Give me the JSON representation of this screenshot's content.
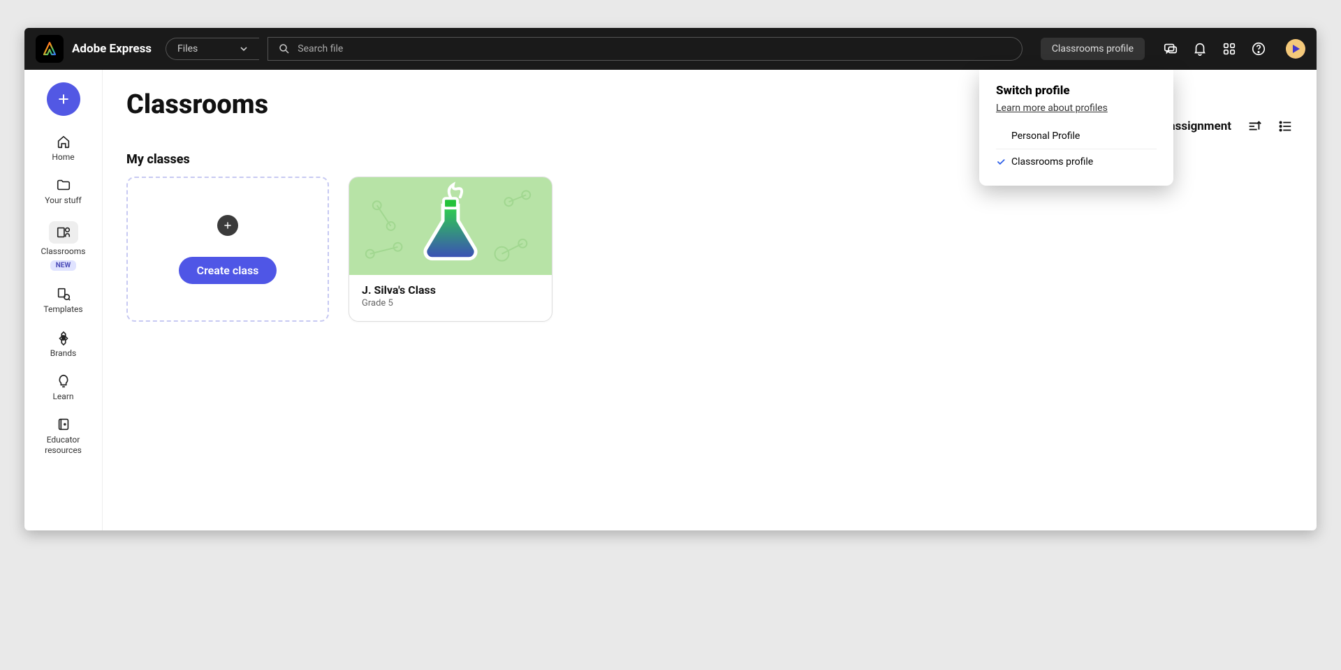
{
  "header": {
    "brand": "Adobe Express",
    "files_dropdown_label": "Files",
    "search_placeholder": "Search file",
    "profile_pill": "Classrooms profile"
  },
  "sidebar": {
    "items": [
      {
        "label": "Home"
      },
      {
        "label": "Your stuff"
      },
      {
        "label": "Classrooms",
        "badge": "NEW"
      },
      {
        "label": "Templates"
      },
      {
        "label": "Brands"
      },
      {
        "label": "Learn"
      },
      {
        "label": "Educator resources"
      }
    ]
  },
  "main": {
    "page_title": "Classrooms",
    "create_assignment": "Create assignment",
    "section_title": "My classes",
    "create_class_button": "Create class",
    "classes": [
      {
        "name": "J. Silva's Class",
        "grade": "Grade 5"
      }
    ]
  },
  "profile_panel": {
    "title": "Switch profile",
    "learn_link": "Learn more about profiles",
    "options": [
      {
        "label": "Personal Profile",
        "selected": false
      },
      {
        "label": "Classrooms profile",
        "selected": true
      }
    ]
  }
}
